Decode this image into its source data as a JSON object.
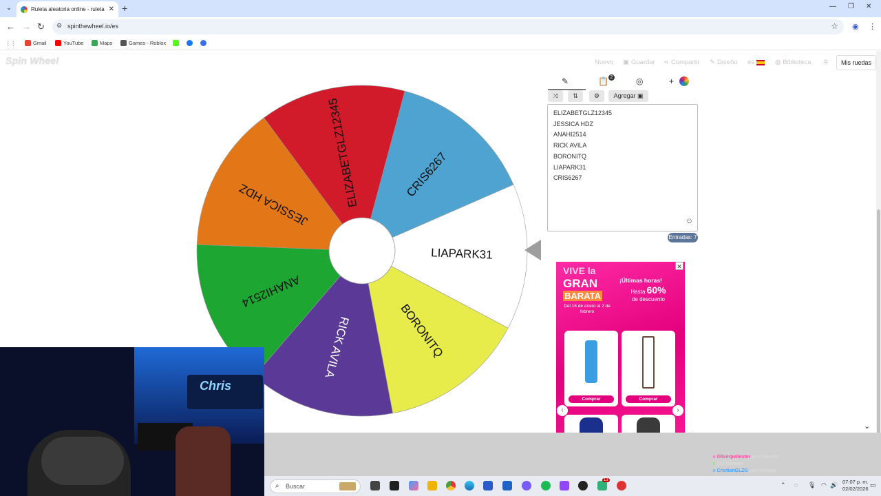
{
  "browser": {
    "tab_title": "Ruleta aleatoria online - ruleta",
    "url": "spinthewheel.io/es",
    "bookmarks": [
      "Gmail",
      "YouTube",
      "Maps",
      "Games - Roblox"
    ]
  },
  "site": {
    "logo": "Spin Wheel",
    "nav": [
      "Nuevo",
      "Guardar",
      "Compartir",
      "Diseño",
      "es",
      "Biblioteca"
    ],
    "mis_ruedas": "Mis ruedas"
  },
  "wheel": {
    "segments": [
      {
        "label": "CRIS6267",
        "color": "#4fa3d1"
      },
      {
        "label": "LIAPARK31",
        "color": "#ffffff"
      },
      {
        "label": "BORONITQ",
        "color": "#e8ec4a"
      },
      {
        "label": "RICK AVILA",
        "color": "#5b3996"
      },
      {
        "label": "ANAHI2514",
        "color": "#1ea633"
      },
      {
        "label": "JESSICA HDZ",
        "color": "#e37717"
      },
      {
        "label": "ELIZABETGLZ12345",
        "color": "#d11a2a"
      }
    ]
  },
  "editor": {
    "clipboard_badge": "2",
    "add_label": "Agregar",
    "entries": [
      "ELIZABETGLZ12345",
      "JESSICA HDZ",
      "ANAHI2514",
      "RICK AVILA",
      "BORONITQ",
      "LIAPARK31",
      "CRIS6267"
    ],
    "entries_count": "Entradas: 7"
  },
  "ad": {
    "line1": "VIVE la",
    "line2": "GRAN",
    "line3": "BARATA",
    "dates": "Del 16 de enero al 2 de febrero",
    "ultimas": "¡Últimas horas!",
    "hasta1": "Hasta",
    "hasta2": "60%",
    "hasta3": "de descuento",
    "buy": "Comprar"
  },
  "webcam": {
    "sign": "Chris"
  },
  "follows": [
    {
      "name": "Oliverpoliester",
      "text": "just followed",
      "color": "#ff4fa8"
    },
    {
      "name": "",
      "text": "just followed",
      "color": "#7cf06a"
    },
    {
      "name": "CristianGLZG",
      "text": "just followed",
      "color": "#4aa3ff"
    }
  ],
  "taskbar": {
    "search": "Buscar",
    "time": "07:07 p. m.",
    "date": "02/02/2026",
    "badge": "13"
  }
}
